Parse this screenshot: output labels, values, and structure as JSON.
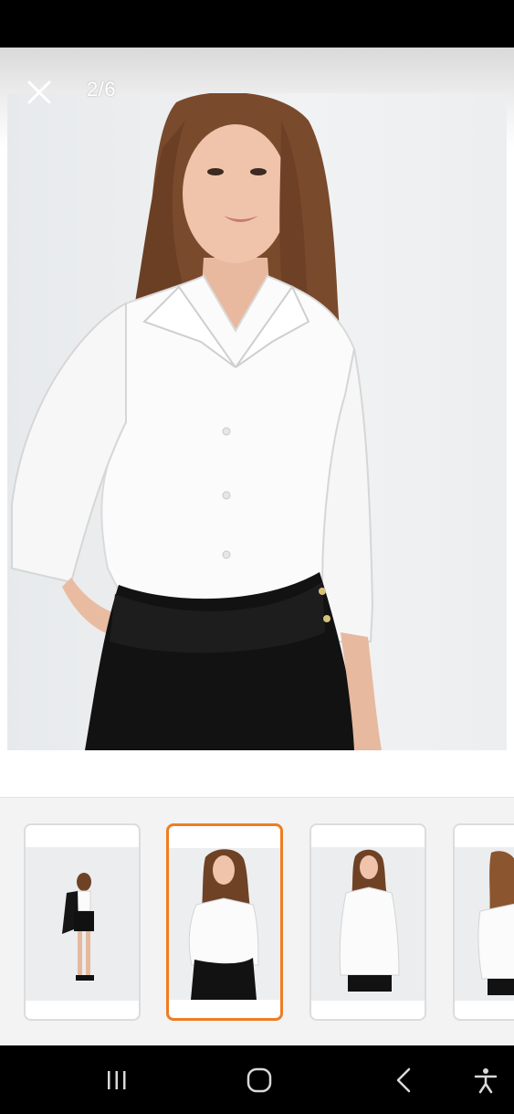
{
  "viewer": {
    "counter": "2/6",
    "current_index": 2,
    "total": 6,
    "close_icon": "close-icon"
  },
  "thumbnails": [
    {
      "name": "thumbnail-1",
      "selected": false
    },
    {
      "name": "thumbnail-2",
      "selected": true
    },
    {
      "name": "thumbnail-3",
      "selected": false
    },
    {
      "name": "thumbnail-4",
      "selected": false
    }
  ],
  "navigation": {
    "icons": [
      "recent-apps-icon",
      "home-icon",
      "back-icon",
      "accessibility-icon"
    ]
  },
  "colors": {
    "selected_border": "#ee7d22",
    "status_bar": "#000000",
    "nav_bar": "#000000"
  }
}
